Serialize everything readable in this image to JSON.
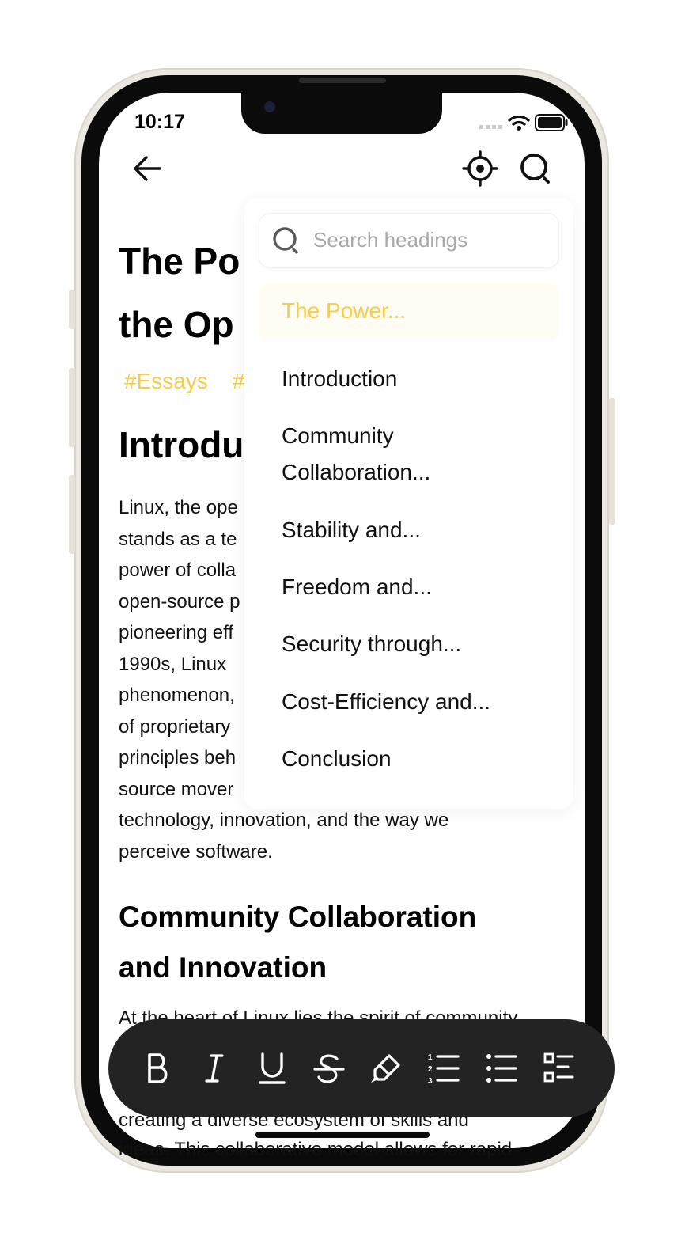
{
  "status_bar": {
    "time": "10:17"
  },
  "nav": {
    "back_icon": "arrow-left-icon",
    "locate_icon": "crosshair-icon",
    "search_icon": "search-icon"
  },
  "document": {
    "title": "The Power of Linux: Unleashing the Open-Source Revolution",
    "title_visible_line1": "The Po",
    "title_visible_line2": "the Op",
    "tags": [
      "#Essays",
      "#"
    ],
    "intro_heading": "Introdu",
    "intro_lines": [
      "Linux, the ope",
      "stands as a te",
      "power of colla",
      "open-source p",
      "pioneering eff",
      "1990s, Linux",
      "phenomenon,",
      "of proprietary",
      "principles beh",
      "source mover",
      "technology, innovation, and the way we",
      "perceive software."
    ],
    "community_heading": "Community Collaboration and Innovation",
    "community_para_line1": "At the heart of Linux lies the spirit of community",
    "community_para_line3": "creating a diverse ecosystem of skills and",
    "community_para_line4": "ideas. This collaborative model allows for rapid"
  },
  "outline": {
    "search_placeholder": "Search headings",
    "active_item": "The Power...",
    "items": [
      "Introduction",
      "Community Collaboration...",
      "Stability and...",
      "Freedom and...",
      "Security through...",
      "Cost-Efficiency and...",
      "Conclusion"
    ]
  },
  "toolbar": {
    "buttons": [
      "bold-icon",
      "italic-icon",
      "underline-icon",
      "strikethrough-icon",
      "highlight-icon",
      "numbered-list-icon",
      "bulleted-list-icon",
      "checklist-icon"
    ]
  },
  "colors": {
    "accent": "#f5cd4e",
    "toolbar_bg": "#232323",
    "text": "#111111"
  }
}
